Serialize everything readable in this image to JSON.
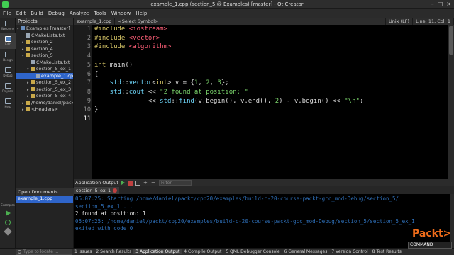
{
  "window": {
    "title": "example_1.cpp (section_5 @ Examples) [master] - Qt Creator"
  },
  "menu": [
    "File",
    "Edit",
    "Build",
    "Debug",
    "Analyze",
    "Tools",
    "Window",
    "Help"
  ],
  "modes": [
    {
      "label": "Welcome",
      "icon": "welcome-icon"
    },
    {
      "label": "Edit",
      "icon": "edit-icon"
    },
    {
      "label": "Design",
      "icon": "design-icon"
    },
    {
      "label": "Debug",
      "icon": "debug-icon"
    },
    {
      "label": "Projects",
      "icon": "projects-icon"
    },
    {
      "label": "Help",
      "icon": "help-icon"
    }
  ],
  "kit": {
    "label": "Examples"
  },
  "projects": {
    "header": "Projects",
    "tree": [
      {
        "label": "Examples [master]",
        "type": "proj",
        "arrow": "▾"
      },
      {
        "label": "CMakeLists.txt",
        "type": "file",
        "arrow": ""
      },
      {
        "label": "section_2",
        "type": "folder",
        "arrow": "▸"
      },
      {
        "label": "section_4",
        "type": "folder",
        "arrow": "▸"
      },
      {
        "label": "section_5",
        "type": "folder",
        "arrow": "▾"
      },
      {
        "label": "CMakeLists.txt",
        "type": "file",
        "arrow": ""
      },
      {
        "label": "section_5_ex_1",
        "type": "folder",
        "arrow": "▾"
      },
      {
        "label": "example_1.cpp",
        "type": "file",
        "arrow": ""
      },
      {
        "label": "section_5_ex_2",
        "type": "folder",
        "arrow": "▸"
      },
      {
        "label": "section_5_ex_3",
        "type": "folder",
        "arrow": "▸"
      },
      {
        "label": "section_5_ex_4",
        "type": "folder",
        "arrow": "▸"
      },
      {
        "label": "/home/daniel/packt",
        "type": "folder",
        "arrow": "▸"
      },
      {
        "label": "<Headers>",
        "type": "folder",
        "arrow": "▸"
      }
    ]
  },
  "open_documents": {
    "header": "Open Documents",
    "items": [
      "example_1.cpp"
    ]
  },
  "editor_toolbar": {
    "file": "example_1.cpp",
    "symbol": "<Select Symbol>",
    "encoding": "Unix (LF)",
    "position": "Line: 11, Col: 1"
  },
  "code": {
    "line_numbers": [
      "1",
      "2",
      "3",
      "4",
      "5",
      "6",
      "7",
      "8",
      "9",
      "10",
      "11"
    ],
    "lines": [
      [
        {
          "t": "#include ",
          "c": "kw"
        },
        {
          "t": "<iostream>",
          "c": "inc"
        }
      ],
      [
        {
          "t": "#include ",
          "c": "kw"
        },
        {
          "t": "<vector>",
          "c": "inc"
        }
      ],
      [
        {
          "t": "#include ",
          "c": "kw"
        },
        {
          "t": "<algorithm>",
          "c": "inc"
        }
      ],
      [],
      [
        {
          "t": "int ",
          "c": "kw"
        },
        {
          "t": "main()",
          "c": "punc"
        }
      ],
      [
        {
          "t": "{",
          "c": "punc"
        }
      ],
      [
        {
          "t": "    std",
          "c": "ns"
        },
        {
          "t": "::",
          "c": "punc"
        },
        {
          "t": "vector",
          "c": "ns"
        },
        {
          "t": "<",
          "c": "punc"
        },
        {
          "t": "int",
          "c": "kw"
        },
        {
          "t": "> v = {",
          "c": "punc"
        },
        {
          "t": "1",
          "c": "num"
        },
        {
          "t": ", ",
          "c": "punc"
        },
        {
          "t": "2",
          "c": "num"
        },
        {
          "t": ", ",
          "c": "punc"
        },
        {
          "t": "3",
          "c": "num"
        },
        {
          "t": "};",
          "c": "punc"
        }
      ],
      [
        {
          "t": "    std",
          "c": "ns"
        },
        {
          "t": "::",
          "c": "punc"
        },
        {
          "t": "cout",
          "c": "ns"
        },
        {
          "t": " << ",
          "c": "punc"
        },
        {
          "t": "\"2 found at position: \"",
          "c": "str"
        }
      ],
      [
        {
          "t": "              << ",
          "c": "punc"
        },
        {
          "t": "std",
          "c": "ns"
        },
        {
          "t": "::",
          "c": "punc"
        },
        {
          "t": "find",
          "c": "ns"
        },
        {
          "t": "(v.begin(), v.end(), ",
          "c": "punc"
        },
        {
          "t": "2",
          "c": "num"
        },
        {
          "t": ") - v.begin() << ",
          "c": "punc"
        },
        {
          "t": "\"\\n\"",
          "c": "str"
        },
        {
          "t": ";",
          "c": "punc"
        }
      ],
      [
        {
          "t": "}",
          "c": "punc"
        }
      ],
      []
    ],
    "current_line": 11
  },
  "output_header": {
    "title": "Application Output",
    "filter_placeholder": "Filter"
  },
  "output_tab": "section_5_ex_1",
  "output": [
    {
      "text": "06:07:25: Starting /home/daniel/packt/cpp20/examples/build-c-20-course-packt-gcc_mod-Debug/section_5/",
      "kind": "sys"
    },
    {
      "text": "section_5_ex_1 ...",
      "kind": "sys"
    },
    {
      "text": "2 found at position: 1",
      "kind": "out"
    },
    {
      "text": "06:07:25: /home/daniel/packt/cpp20/examples/build-c-20-course-packt-gcc_mod-Debug/section_5/section_5_ex_1",
      "kind": "sys"
    },
    {
      "text": "exited with code 0",
      "kind": "sys"
    }
  ],
  "status": {
    "locator_placeholder": "Type to locate ...",
    "panes": [
      "1 Issues",
      "2 Search Results",
      "3 Application Output",
      "4 Compile Output",
      "5 QML Debugger Console",
      "6 General Messages",
      "7 Version Control",
      "8 Test Results"
    ],
    "active_pane": 2
  },
  "watermark": {
    "brand": "Packt>",
    "badge": "COMMAND"
  },
  "colors": {
    "selection": "#2f65ca",
    "keyword": "#d7c667",
    "string": "#7ad36b",
    "include": "#ff5f78",
    "namespace": "#6cd2f5",
    "system_output": "#2e6fb8"
  }
}
